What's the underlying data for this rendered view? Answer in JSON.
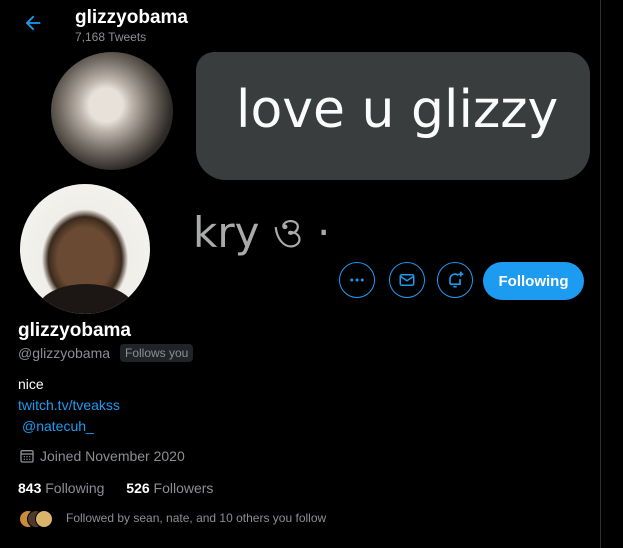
{
  "header": {
    "title": "glizzyobama",
    "tweet_count": "7,168 Tweets"
  },
  "banner": {
    "message": "love u glizzy",
    "signature": "kry ও ·"
  },
  "actions": {
    "more_icon": "more-icon",
    "message_icon": "mail-icon",
    "notify_icon": "bell-plus-icon",
    "follow_label": "Following"
  },
  "profile": {
    "name": "glizzyobama",
    "handle": "@glizzyobama",
    "follows_you": "Follows you",
    "bio": "nice",
    "link": "twitch.tv/tveakss",
    "mention": "@natecuh_",
    "joined": "Joined November 2020",
    "following_count": "843",
    "following_label": "Following",
    "followers_count": "526",
    "followers_label": "Followers",
    "followed_by": "Followed by sean, nate, and 10 others you follow"
  },
  "colors": {
    "accent": "#1d9bf0",
    "background": "#000000",
    "muted": "#8b8f93"
  }
}
